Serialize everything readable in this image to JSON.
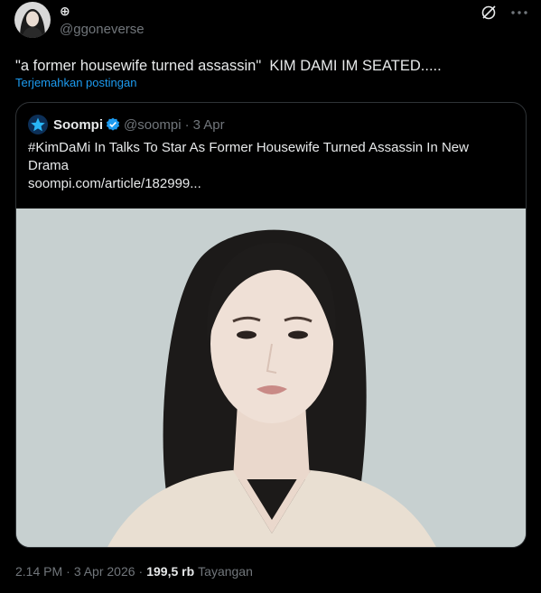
{
  "author": {
    "display_name": "⊕",
    "handle": "@ggoneverse",
    "avatar_icon": "user-avatar"
  },
  "tweet": {
    "text": "\"a former housewife turned assassin\"  KIM DAMI IM SEATED.....",
    "translate_label": "Terjemahkan postingan"
  },
  "quote": {
    "name": "Soompi",
    "handle": "@soompi",
    "separator": "·",
    "date": "3 Apr",
    "text": "#KimDaMi In Talks To Star As Former Housewife Turned Assassin In New Drama",
    "link": "soompi.com/article/182999...",
    "image_alt": "portrait photo"
  },
  "footer": {
    "time": "2.14 PM",
    "separator": "·",
    "date": "3 Apr 2026",
    "views_count": "199,5 rb",
    "views_label": "Tayangan"
  },
  "colors": {
    "background": "#000000",
    "text": "#e7e9ea",
    "muted": "#71767b",
    "link": "#1d9bf0",
    "border": "#2f3336"
  }
}
